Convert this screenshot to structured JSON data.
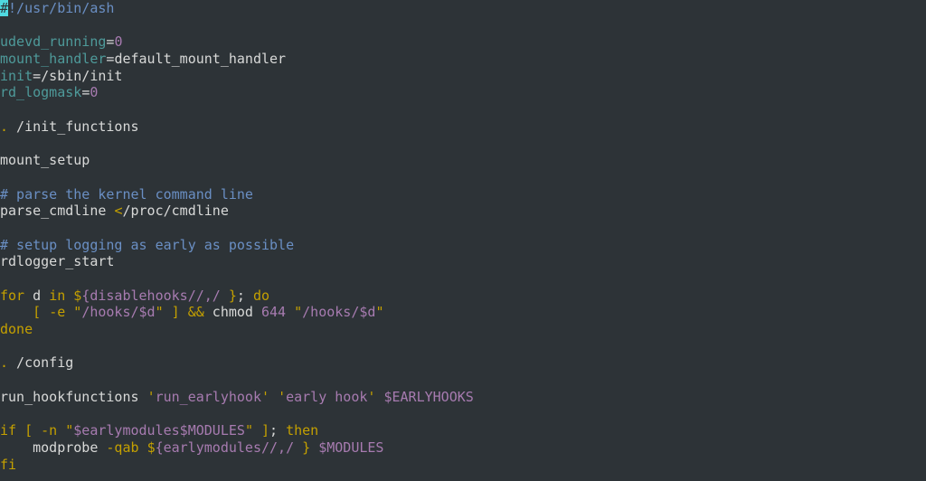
{
  "window": {
    "kind": "terminal-text-editor",
    "background_color": "#2d3337",
    "font_size_px": 15,
    "line_height_px": 18.7,
    "columns_visible": 128,
    "rows_visible": 28
  },
  "palette": {
    "background": "#2d3337",
    "foreground": "#d8d9d8",
    "comment": "#6a8fc4",
    "variable_name": "#4e9a9a",
    "keyword": "#c4a000",
    "operator": "#c4a000",
    "string": "#a77bb0",
    "number": "#a77bb0",
    "substitution": "#a77bb0",
    "quote": "#c4a000",
    "cursor_background": "#4fd9e0",
    "cursor_foreground": "#2d3337"
  },
  "cursor": {
    "row": 1,
    "column": 1,
    "char": "#",
    "style": "block"
  },
  "document": {
    "language": "shell",
    "shebang": "#!/usr/bin/ash",
    "lines": [
      {
        "n": 1,
        "text": "#!/usr/bin/ash",
        "tokens": [
          {
            "t": "#",
            "c": "cursor"
          },
          {
            "t": "!/usr/bin/ash",
            "c": "comment"
          }
        ]
      },
      {
        "n": 2,
        "text": "",
        "tokens": []
      },
      {
        "n": 3,
        "text": "udevd_running=0",
        "tokens": [
          {
            "t": "udevd_running",
            "c": "var"
          },
          {
            "t": "=",
            "c": "plain"
          },
          {
            "t": "0",
            "c": "num"
          }
        ]
      },
      {
        "n": 4,
        "text": "mount_handler=default_mount_handler",
        "tokens": [
          {
            "t": "mount_handler",
            "c": "var"
          },
          {
            "t": "=",
            "c": "plain"
          },
          {
            "t": "default_mount_handler",
            "c": "plain"
          }
        ]
      },
      {
        "n": 5,
        "text": "init=/sbin/init",
        "tokens": [
          {
            "t": "init",
            "c": "var"
          },
          {
            "t": "=",
            "c": "plain"
          },
          {
            "t": "/sbin/init",
            "c": "plain"
          }
        ]
      },
      {
        "n": 6,
        "text": "rd_logmask=0",
        "tokens": [
          {
            "t": "rd_logmask",
            "c": "var"
          },
          {
            "t": "=",
            "c": "plain"
          },
          {
            "t": "0",
            "c": "num"
          }
        ]
      },
      {
        "n": 7,
        "text": "",
        "tokens": []
      },
      {
        "n": 8,
        "text": ". /init_functions",
        "tokens": [
          {
            "t": ".",
            "c": "kw"
          },
          {
            "t": " /init_functions",
            "c": "plain"
          }
        ]
      },
      {
        "n": 9,
        "text": "",
        "tokens": []
      },
      {
        "n": 10,
        "text": "mount_setup",
        "tokens": [
          {
            "t": "mount_setup",
            "c": "plain"
          }
        ]
      },
      {
        "n": 11,
        "text": "",
        "tokens": []
      },
      {
        "n": 12,
        "text": "# parse the kernel command line",
        "tokens": [
          {
            "t": "# parse the kernel command line",
            "c": "comment"
          }
        ]
      },
      {
        "n": 13,
        "text": "parse_cmdline </proc/cmdline",
        "tokens": [
          {
            "t": "parse_cmdline ",
            "c": "plain"
          },
          {
            "t": "<",
            "c": "op"
          },
          {
            "t": "/proc/cmdline",
            "c": "plain"
          }
        ]
      },
      {
        "n": 14,
        "text": "",
        "tokens": []
      },
      {
        "n": 15,
        "text": "# setup logging as early as possible",
        "tokens": [
          {
            "t": "# setup logging as early as possible",
            "c": "comment"
          }
        ]
      },
      {
        "n": 16,
        "text": "rdlogger_start",
        "tokens": [
          {
            "t": "rdlogger_start",
            "c": "plain"
          }
        ]
      },
      {
        "n": 17,
        "text": "",
        "tokens": []
      },
      {
        "n": 18,
        "text": "for d in ${disablehooks//,/ }; do",
        "tokens": [
          {
            "t": "for",
            "c": "kw"
          },
          {
            "t": " d ",
            "c": "plain"
          },
          {
            "t": "in",
            "c": "kw"
          },
          {
            "t": " ",
            "c": "plain"
          },
          {
            "t": "$",
            "c": "quote"
          },
          {
            "t": "{disablehooks//,/ ",
            "c": "subst"
          },
          {
            "t": "}",
            "c": "quote"
          },
          {
            "t": "; ",
            "c": "plain"
          },
          {
            "t": "do",
            "c": "kw"
          }
        ]
      },
      {
        "n": 19,
        "text": "    [ -e \"/hooks/$d\" ] && chmod 644 \"/hooks/$d\"",
        "tokens": [
          {
            "t": "    ",
            "c": "plain"
          },
          {
            "t": "[",
            "c": "kw"
          },
          {
            "t": " ",
            "c": "plain"
          },
          {
            "t": "-e",
            "c": "kw"
          },
          {
            "t": " ",
            "c": "plain"
          },
          {
            "t": "\"",
            "c": "quote"
          },
          {
            "t": "/hooks/$d",
            "c": "str"
          },
          {
            "t": "\"",
            "c": "quote"
          },
          {
            "t": " ",
            "c": "plain"
          },
          {
            "t": "]",
            "c": "kw"
          },
          {
            "t": " ",
            "c": "plain"
          },
          {
            "t": "&&",
            "c": "kw"
          },
          {
            "t": " chmod ",
            "c": "plain"
          },
          {
            "t": "644",
            "c": "num"
          },
          {
            "t": " ",
            "c": "plain"
          },
          {
            "t": "\"",
            "c": "quote"
          },
          {
            "t": "/hooks/$d",
            "c": "str"
          },
          {
            "t": "\"",
            "c": "quote"
          }
        ]
      },
      {
        "n": 20,
        "text": "done",
        "tokens": [
          {
            "t": "done",
            "c": "kw"
          }
        ]
      },
      {
        "n": 21,
        "text": "",
        "tokens": []
      },
      {
        "n": 22,
        "text": ". /config",
        "tokens": [
          {
            "t": ".",
            "c": "kw"
          },
          {
            "t": " /config",
            "c": "plain"
          }
        ]
      },
      {
        "n": 23,
        "text": "",
        "tokens": []
      },
      {
        "n": 24,
        "text": "run_hookfunctions 'run_earlyhook' 'early hook' $EARLYHOOKS",
        "tokens": [
          {
            "t": "run_hookfunctions ",
            "c": "plain"
          },
          {
            "t": "'",
            "c": "quote"
          },
          {
            "t": "run_earlyhook",
            "c": "str"
          },
          {
            "t": "'",
            "c": "quote"
          },
          {
            "t": " ",
            "c": "plain"
          },
          {
            "t": "'",
            "c": "quote"
          },
          {
            "t": "early hook",
            "c": "str"
          },
          {
            "t": "'",
            "c": "quote"
          },
          {
            "t": " ",
            "c": "plain"
          },
          {
            "t": "$EARLYHOOKS",
            "c": "subst"
          }
        ]
      },
      {
        "n": 25,
        "text": "",
        "tokens": []
      },
      {
        "n": 26,
        "text": "if [ -n \"$earlymodules$MODULES\" ]; then",
        "tokens": [
          {
            "t": "if",
            "c": "kw"
          },
          {
            "t": " ",
            "c": "plain"
          },
          {
            "t": "[",
            "c": "kw"
          },
          {
            "t": " ",
            "c": "plain"
          },
          {
            "t": "-n",
            "c": "kw"
          },
          {
            "t": " ",
            "c": "plain"
          },
          {
            "t": "\"",
            "c": "quote"
          },
          {
            "t": "$earlymodules$MODULES",
            "c": "subst"
          },
          {
            "t": "\"",
            "c": "quote"
          },
          {
            "t": " ",
            "c": "plain"
          },
          {
            "t": "]",
            "c": "kw"
          },
          {
            "t": "; ",
            "c": "plain"
          },
          {
            "t": "then",
            "c": "kw"
          }
        ]
      },
      {
        "n": 27,
        "text": "    modprobe -qab ${earlymodules//,/ } $MODULES",
        "tokens": [
          {
            "t": "    modprobe ",
            "c": "plain"
          },
          {
            "t": "-qab",
            "c": "kw"
          },
          {
            "t": " ",
            "c": "plain"
          },
          {
            "t": "$",
            "c": "quote"
          },
          {
            "t": "{earlymodules//,/ ",
            "c": "subst"
          },
          {
            "t": "}",
            "c": "quote"
          },
          {
            "t": " ",
            "c": "plain"
          },
          {
            "t": "$MODULES",
            "c": "subst"
          }
        ]
      },
      {
        "n": 28,
        "text": "fi",
        "tokens": [
          {
            "t": "fi",
            "c": "kw"
          }
        ]
      }
    ]
  }
}
